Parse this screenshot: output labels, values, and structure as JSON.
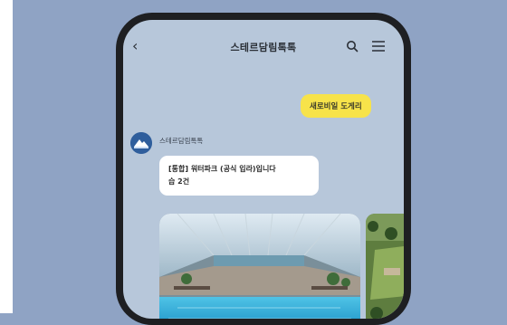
{
  "chat": {
    "title": "스테르담림톡톡",
    "sender_name": "스테르담림톡톡",
    "messages": {
      "sent": "새로비일 도게리",
      "received_line1": "[통합] 워터파크 (공식 입라)입니다",
      "received_line2": "습 2건"
    }
  },
  "icons": {
    "back": "chevron-left-icon",
    "search": "search-icon",
    "menu": "hamburger-menu-icon",
    "avatar": "mountain-logo-icon"
  },
  "colors": {
    "background": "#8fa3c4",
    "chat_bg": "#b7c7da",
    "sent_bubble": "#f7e34a",
    "phone_frame": "#1e1f22"
  }
}
